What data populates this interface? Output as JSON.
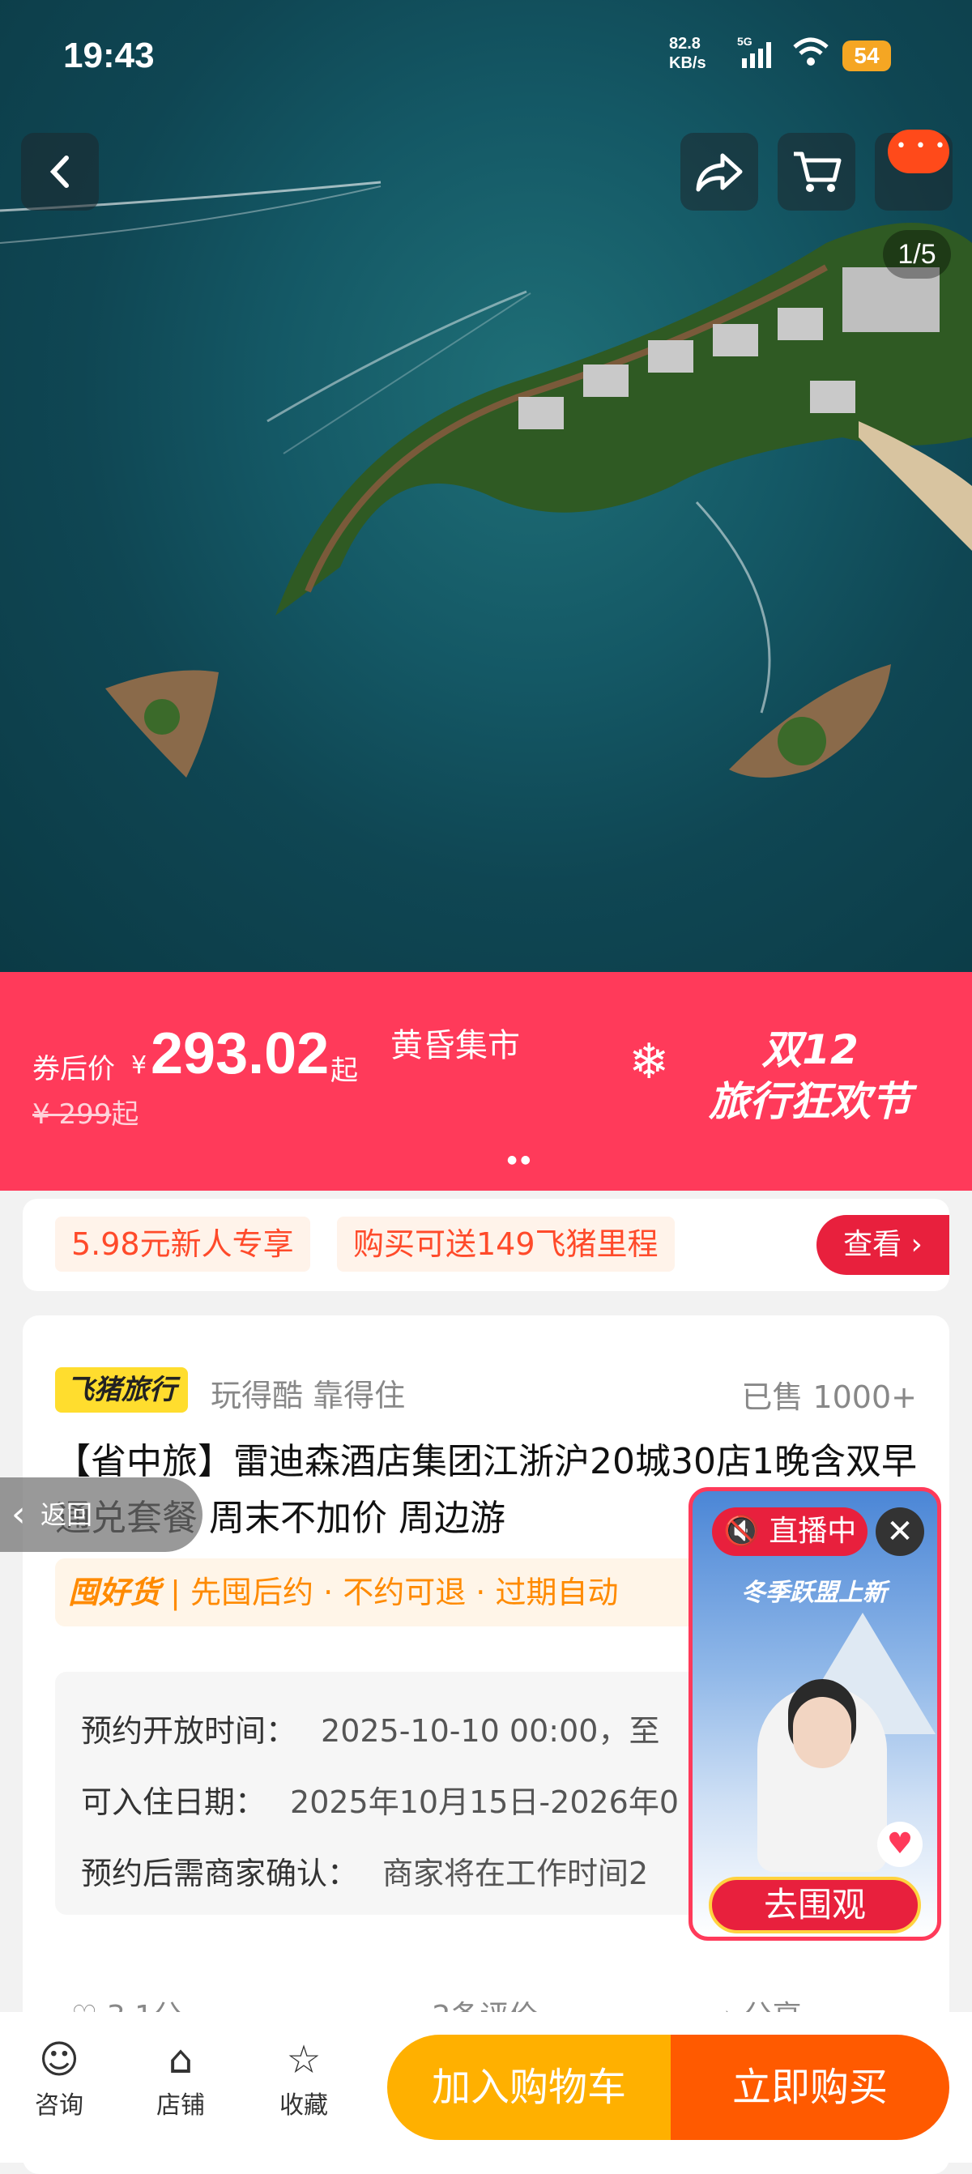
{
  "status_bar": {
    "time": "19:43",
    "net_speed_top": "82.8",
    "net_speed_bottom": "KB/s",
    "net_type": "5G",
    "battery": "54"
  },
  "gallery": {
    "counter": "1/5"
  },
  "price": {
    "prefix": "券后价",
    "currency": "¥",
    "value": "293.02",
    "suffix": "起",
    "original": "¥ 299",
    "original_suffix": "起",
    "market_label": "黄昏集市",
    "festival_line1": "双12",
    "festival_line2": "旅行狂欢节"
  },
  "coupons": {
    "items": [
      "5.98元新人专享",
      "购买可送149飞猪里程"
    ],
    "view_label": "查看 ›"
  },
  "product": {
    "brand": "飞猪旅行",
    "slogan": "玩得酷 靠得住",
    "sold": "已售 1000+",
    "title": "【省中旅】雷迪森酒店集团江浙沪20城30店1晚含双早通兑套餐 周末不加价 周边游",
    "guarantee_brand": "囤好货",
    "guarantee_text": "| 先囤后约 · 不约可退 · 过期自动",
    "info": [
      {
        "label": "预约开放时间：",
        "value": "2025-10-10 00:00，至"
      },
      {
        "label": "可入住日期：",
        "value": "2025年10月15日-2026年0"
      },
      {
        "label": "预约后需商家确认：",
        "value": "商家将在工作时间2"
      }
    ],
    "stats": {
      "score": "3.1分",
      "reviews": "2条评价",
      "share": "分享"
    }
  },
  "back_pill": "返回",
  "live": {
    "tag": "直播中",
    "headline": "冬季跃盟上新",
    "cta": "去围观"
  },
  "bottom_nav": {
    "items": [
      {
        "label": "咨询"
      },
      {
        "label": "店铺"
      },
      {
        "label": "收藏"
      }
    ],
    "add_to_cart": "加入购物车",
    "buy_now": "立即购买"
  }
}
